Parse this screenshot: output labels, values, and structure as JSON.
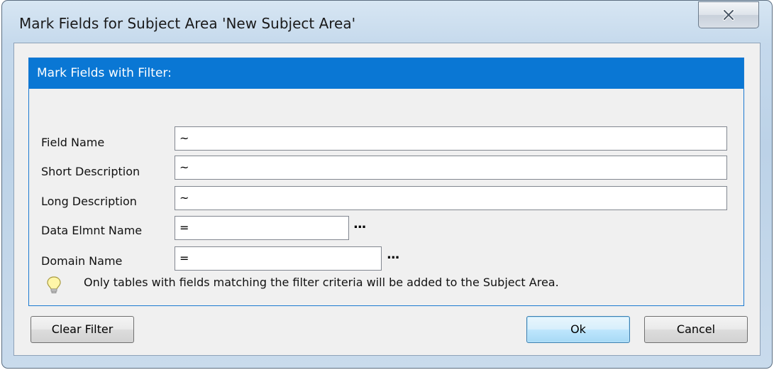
{
  "window": {
    "title": "Mark Fields for Subject Area 'New Subject Area'"
  },
  "filter_group": {
    "header": "Mark Fields with Filter:",
    "fields": [
      {
        "label": "Field Name",
        "value": "~"
      },
      {
        "label": "Short Description",
        "value": "~"
      },
      {
        "label": "Long Description",
        "value": "~"
      },
      {
        "label": "Data Elmnt Name",
        "value": "=",
        "browse": "..."
      },
      {
        "label": "Domain Name",
        "value": "=",
        "browse": "..."
      }
    ],
    "tip": {
      "icon": "lightbulb-icon",
      "text": "Only tables with fields matching the filter criteria will be added to the Subject Area."
    }
  },
  "buttons": {
    "clear_filter": "Clear Filter",
    "ok": "Ok",
    "cancel": "Cancel"
  },
  "colors": {
    "header_bg": "#0a77d4",
    "accent_border": "#1c7ad1"
  }
}
